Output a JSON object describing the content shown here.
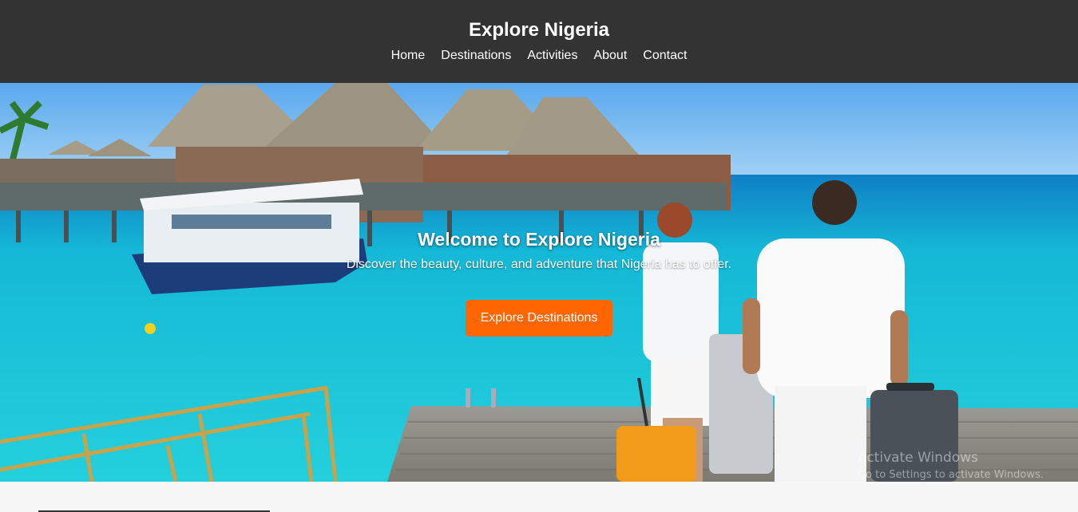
{
  "header": {
    "title": "Explore Nigeria",
    "nav": [
      "Home",
      "Destinations",
      "Activities",
      "About",
      "Contact"
    ]
  },
  "hero": {
    "title": "Welcome to Explore Nigeria",
    "subtitle": "Discover the beauty, culture, and adventure that Nigeria has to offer.",
    "cta_label": "Explore Destinations"
  },
  "watermark": {
    "line1": "Activate Windows",
    "line2": "Go to Settings to activate Windows."
  },
  "colors": {
    "header_bg": "#333333",
    "accent": "#ff6600",
    "sea": "#1ec8d6",
    "sky": "#6fb6f0"
  }
}
